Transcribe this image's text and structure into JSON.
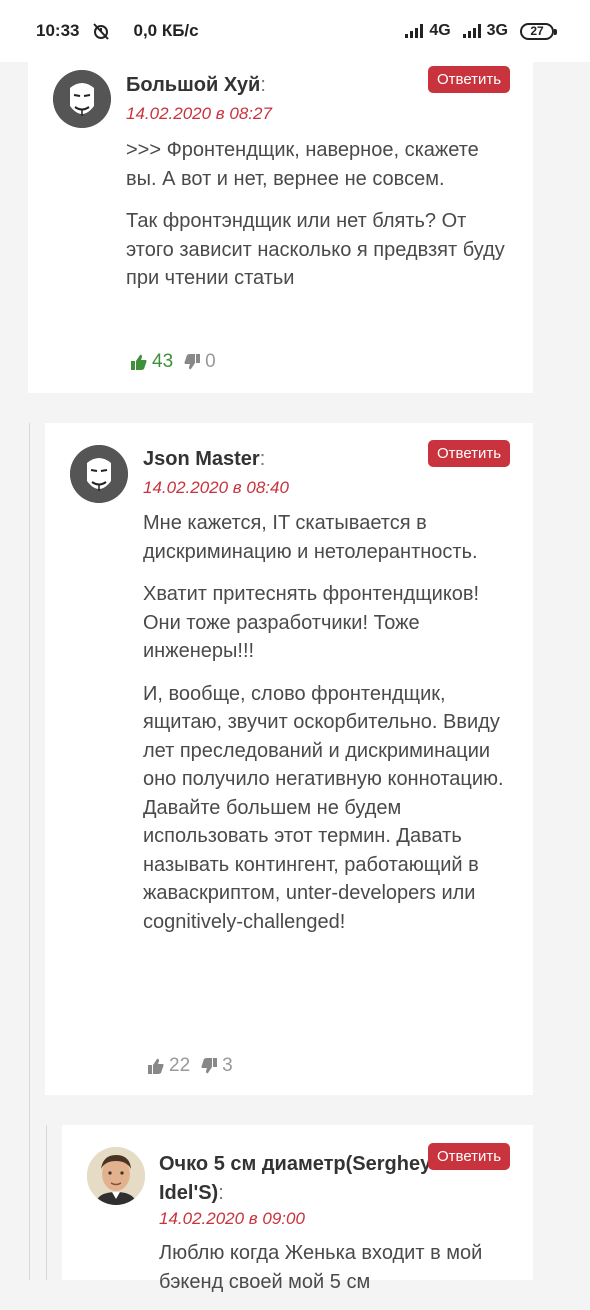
{
  "status_bar": {
    "time": "10:33",
    "speed": "0,0 КБ/с",
    "net1": "4G",
    "net2": "3G",
    "battery": "27"
  },
  "comments": [
    {
      "author": "Большой Хуй",
      "date": "14.02.2020 в 08:27",
      "reply_label": "Ответить",
      "paragraphs": [
        ">>> Фронтендщик, наверное, скажете вы. А вот и нет, вернее не совсем.",
        "Так фронтэндщик или нет блять? От этого зависит насколько я предвзят буду при чтении статьи"
      ],
      "likes": "43",
      "dislikes": "0",
      "avatar": "anonymous-mask"
    },
    {
      "author": "Json Master",
      "date": "14.02.2020 в 08:40",
      "reply_label": "Ответить",
      "paragraphs": [
        "Мне кажется, IT скатывается в дискриминацию и нетолерантность.",
        "Хватит притеснять фронтендщиков! Они тоже разработчики! Тоже инженеры!!!",
        "И, вообще, слово фронтендщик, ящитаю, звучит оскорбительно. Ввиду лет преследований и дискриминации оно получило негативную коннотацию. Давайте большем не будем использовать этот термин. Давать называть контингент, работающий в жаваскриптом, unter-developers или cognitively-challenged!"
      ],
      "likes": "22",
      "dislikes": "3",
      "avatar": "anonymous-mask"
    },
    {
      "author": "Очко 5 см диаметр(Serghey Idel'S)",
      "date": "14.02.2020 в 09:00",
      "reply_label": "Ответить",
      "paragraphs": [
        "Люблю когда Женька входит в мой бэкенд своей мой 5 см"
      ],
      "avatar": "user-photo"
    }
  ]
}
